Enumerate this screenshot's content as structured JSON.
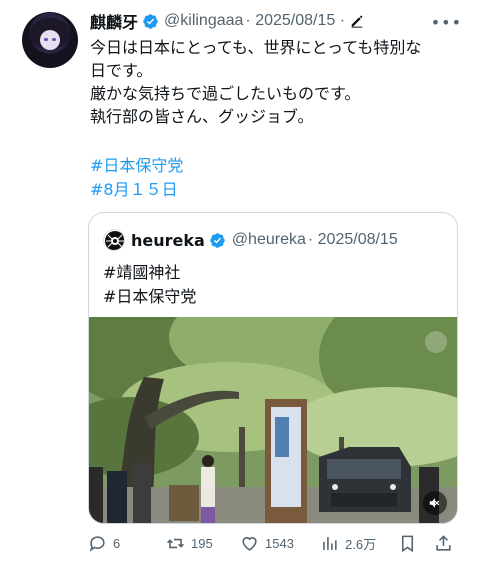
{
  "post": {
    "display_name": "麒麟牙",
    "handle": "@kilingaaa",
    "date": "· 2025/08/15 ·",
    "lines": [
      "今日は日本にとっても、世界にとっても特別な",
      "日です。",
      "厳かな気持ちで過ごしたいものです。",
      "執行部の皆さん、グッジョブ。"
    ],
    "hashtags": [
      "#日本保守党",
      "#8月１５日"
    ]
  },
  "quote": {
    "display_name": "heureka",
    "handle": "@heureka",
    "date": "· 2025/08/15",
    "hashtags": [
      "#靖國神社",
      "#日本保守党"
    ]
  },
  "actions": {
    "replies": "6",
    "reposts": "195",
    "likes": "1543",
    "views": "2.6万"
  },
  "colors": {
    "accent": "#1d9bf0",
    "secondary_text": "#536471",
    "border": "#cfd9de"
  },
  "icons": [
    "verified-badge-icon",
    "edit-icon",
    "more-icon",
    "reply-icon",
    "repost-icon",
    "like-icon",
    "views-icon",
    "bookmark-icon",
    "share-icon",
    "mute-icon"
  ]
}
